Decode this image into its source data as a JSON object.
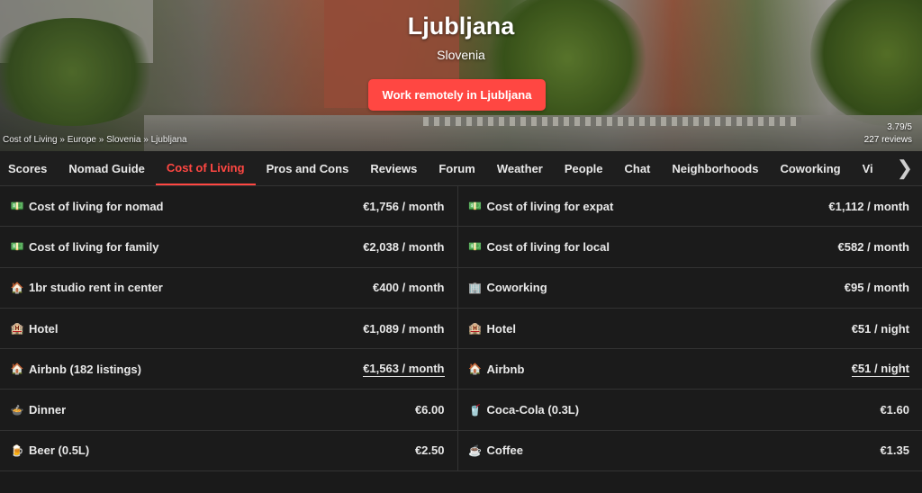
{
  "hero": {
    "city": "Ljubljana",
    "country": "Slovenia",
    "cta_label": "Work remotely in Ljubljana",
    "breadcrumb": [
      "Cost of Living",
      "Europe",
      "Slovenia",
      "Ljubljana"
    ],
    "breadcrumb_sep": " » ",
    "score": "3.79/5",
    "reviews": "227 reviews"
  },
  "tabs": [
    "Scores",
    "Nomad Guide",
    "Cost of Living",
    "Pros and Cons",
    "Reviews",
    "Forum",
    "Weather",
    "People",
    "Chat",
    "Neighborhoods",
    "Coworking",
    "Vi"
  ],
  "active_tab": "Cost of Living",
  "costs_left": [
    {
      "icon": "money-icon",
      "label": "Cost of living for nomad",
      "value": "€1,756 / month"
    },
    {
      "icon": "money-icon",
      "label": "Cost of living for family",
      "value": "€2,038 / month"
    },
    {
      "icon": "house-icon",
      "label": "1br studio rent in center",
      "value": "€400 / month"
    },
    {
      "icon": "hotel-icon",
      "label": "Hotel",
      "value": "€1,089 / month"
    },
    {
      "icon": "house-icon",
      "label": "Airbnb (182 listings)",
      "value": "€1,563 / month",
      "link": true
    },
    {
      "icon": "dinner-icon",
      "label": "Dinner",
      "value": "€6.00"
    },
    {
      "icon": "beer-icon",
      "label": "Beer (0.5L)",
      "value": "€2.50"
    }
  ],
  "costs_right": [
    {
      "icon": "money-icon",
      "label": "Cost of living for expat",
      "value": "€1,112 / month"
    },
    {
      "icon": "money-icon",
      "label": "Cost of living for local",
      "value": "€582 / month"
    },
    {
      "icon": "office-icon",
      "label": "Coworking",
      "value": "€95 / month"
    },
    {
      "icon": "hotel-icon",
      "label": "Hotel",
      "value": "€51 / night"
    },
    {
      "icon": "house-icon",
      "label": "Airbnb",
      "value": "€51 / night",
      "link": true
    },
    {
      "icon": "cola-icon",
      "label": "Coca-Cola (0.3L)",
      "value": "€1.60"
    },
    {
      "icon": "coffee-icon",
      "label": "Coffee",
      "value": "€1.35"
    }
  ],
  "colors": {
    "accent": "#ff4742",
    "background": "#1b1b1b",
    "border": "#333333"
  }
}
